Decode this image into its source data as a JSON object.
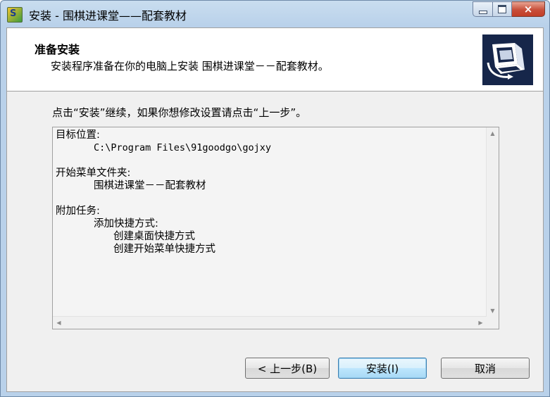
{
  "window": {
    "title": "安装 - 围棋进课堂——配套教材",
    "app_icon_glyph": "S",
    "buttons": {
      "minimize": "minimize",
      "maximize": "maximize",
      "close": "×"
    }
  },
  "header": {
    "title": "准备安装",
    "subtitle": "安装程序准备在你的电脑上安装 围棋进课堂－－配套教材。"
  },
  "prompt": "点击“安装”继续，如果你想修改设置请点击“上一步”。",
  "summary": {
    "dest_label": "目标位置:",
    "dest_value": "C:\\Program Files\\91goodgo\\gojxy",
    "start_menu_label": "开始菜单文件夹:",
    "start_menu_value": "围棋进课堂－－配套教材",
    "tasks_label": "附加任务:",
    "tasks_group": "添加快捷方式:",
    "task_1": "创建桌面快捷方式",
    "task_2": "创建开始菜单快捷方式"
  },
  "footer": {
    "back_label": "< 上一步(B)",
    "install_label": "安装(I)",
    "cancel_label": "取消"
  },
  "colors": {
    "title_bar": "#b9d1ea",
    "close_button": "#c84f3a",
    "default_button_border": "#3c7fb1",
    "logo_background": "#16264a"
  }
}
